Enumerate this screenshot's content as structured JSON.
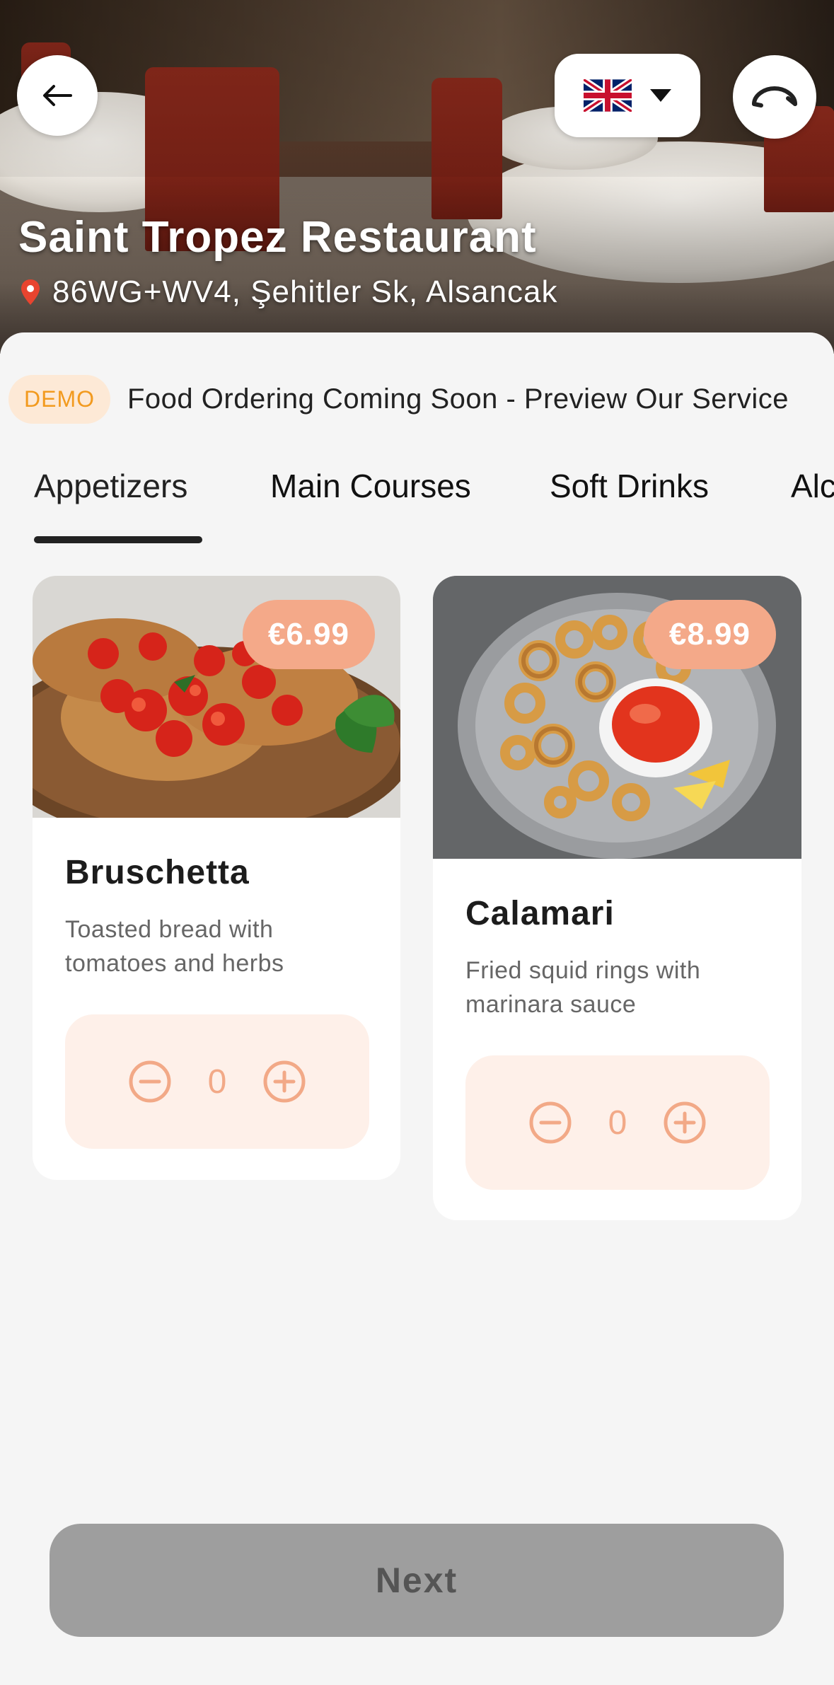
{
  "header": {
    "restaurant_name": "Saint Tropez Restaurant",
    "address": "86WG+WV4, Şehitler Sk, Alsancak",
    "language": "English (UK flag)",
    "icons": {
      "back": "arrow-left-icon",
      "call": "phone-hangup-icon",
      "dropdown": "caret-down-icon",
      "location": "map-pin-icon"
    }
  },
  "banner": {
    "badge": "DEMO",
    "text": "Food Ordering Coming Soon - Preview Our Service"
  },
  "tabs": [
    {
      "label": "Appetizers",
      "active": true
    },
    {
      "label": "Main Courses",
      "active": false
    },
    {
      "label": "Soft Drinks",
      "active": false
    },
    {
      "label": "Alc",
      "active": false
    }
  ],
  "items": [
    {
      "name": "Bruschetta",
      "description": "Toasted bread with tomatoes and herbs",
      "price": "€6.99",
      "quantity": "0"
    },
    {
      "name": "Calamari",
      "description": "Fried squid rings with marinara sauce",
      "price": "€8.99",
      "quantity": "0"
    }
  ],
  "footer": {
    "next_label": "Next"
  },
  "colors": {
    "accent": "#f4a989",
    "stepper_bg": "#fef0e9",
    "demo_badge_text": "#f29a1e",
    "next_disabled": "#9e9e9e"
  }
}
